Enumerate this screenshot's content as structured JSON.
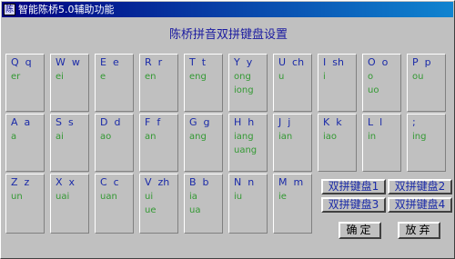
{
  "window": {
    "title": "智能陈桥5.0辅助功能",
    "icon_label": "陈"
  },
  "heading": "陈桥拼音双拼键盘设置",
  "rows": [
    [
      {
        "label": "Q  q",
        "finals": [
          "er"
        ]
      },
      {
        "label": "W  w",
        "finals": [
          "ei"
        ]
      },
      {
        "label": "E  e",
        "finals": [
          "e"
        ]
      },
      {
        "label": "R  r",
        "finals": [
          "en"
        ]
      },
      {
        "label": "T  t",
        "finals": [
          "eng"
        ]
      },
      {
        "label": "Y  y",
        "finals": [
          "ong",
          "iong"
        ]
      },
      {
        "label": "U  ch",
        "finals": [
          "u"
        ]
      },
      {
        "label": "I  sh",
        "finals": [
          "i"
        ]
      },
      {
        "label": "O  o",
        "finals": [
          "o",
          "uo"
        ]
      },
      {
        "label": "P  p",
        "finals": [
          "ou"
        ]
      }
    ],
    [
      {
        "label": "A  a",
        "finals": [
          "a"
        ]
      },
      {
        "label": "S  s",
        "finals": [
          "ai"
        ]
      },
      {
        "label": "D  d",
        "finals": [
          "ao"
        ]
      },
      {
        "label": "F  f",
        "finals": [
          "an"
        ]
      },
      {
        "label": "G  g",
        "finals": [
          "ang"
        ]
      },
      {
        "label": "H  h",
        "finals": [
          "iang",
          "uang"
        ]
      },
      {
        "label": "J  j",
        "finals": [
          "ian"
        ]
      },
      {
        "label": "K  k",
        "finals": [
          "iao"
        ]
      },
      {
        "label": "L  l",
        "finals": [
          "in"
        ]
      },
      {
        "label": ";",
        "finals": [
          "ing"
        ]
      }
    ],
    [
      {
        "label": "Z  z",
        "finals": [
          "un"
        ]
      },
      {
        "label": "X  x",
        "finals": [
          "uai"
        ]
      },
      {
        "label": "C  c",
        "finals": [
          "uan"
        ]
      },
      {
        "label": "V  zh",
        "finals": [
          "ui",
          "ue"
        ]
      },
      {
        "label": "B  b",
        "finals": [
          "ia",
          "ua"
        ]
      },
      {
        "label": "N  n",
        "finals": [
          "iu"
        ]
      },
      {
        "label": "M  m",
        "finals": [
          "ie"
        ]
      }
    ]
  ],
  "scheme_buttons": [
    "双拼键盘1",
    "双拼键盘2",
    "双拼键盘3",
    "双拼键盘4"
  ],
  "buttons": {
    "ok": "确定",
    "cancel": "放弃"
  }
}
